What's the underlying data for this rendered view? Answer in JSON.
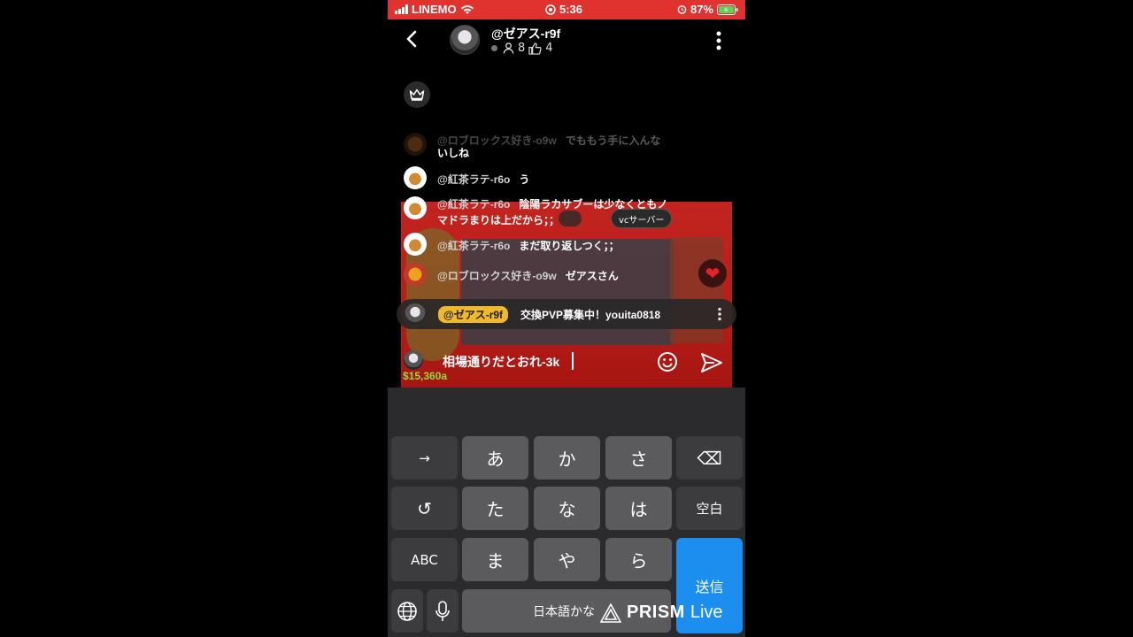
{
  "status": {
    "carrier": "LINEMO",
    "time": "5:36",
    "battery": "87%"
  },
  "host": {
    "name": "@ゼアス-r9f",
    "viewers": "8",
    "likes": "4"
  },
  "chat": [
    {
      "name": "@ロブロックス好き-o9w",
      "text": "でももう手に入んな",
      "cont": "いしね"
    },
    {
      "name": "@紅茶ラテ-r6o",
      "text": "う"
    },
    {
      "name": "@紅茶ラテ-r6o",
      "text": "陰陽ラカサブーは少なくともノ",
      "cont": "マドラまりは上だから；；"
    },
    {
      "name": "@紅茶ラテ-r6o",
      "text": "まだ取り返しつく；；"
    },
    {
      "name": "@ロブロックス好き-o9w",
      "text": "ゼアスさん"
    }
  ],
  "video": {
    "money": "$15,360a",
    "chip": "vcサーバー"
  },
  "pinned": {
    "badge": "@ゼアス-r9f",
    "text": "交換PVP募集中！youita0818"
  },
  "input": {
    "value": "相場通りだとおれ-3k"
  },
  "keyboard": {
    "row1": [
      "→",
      "あ",
      "か",
      "さ",
      "⌫"
    ],
    "row2": [
      "↺",
      "た",
      "な",
      "は",
      "空白"
    ],
    "row3": [
      "ABC",
      "ま",
      "や",
      "ら"
    ],
    "send": "送信",
    "space": "日本語かな"
  },
  "watermark": {
    "brand": "PRISM",
    "suffix": "Live"
  }
}
